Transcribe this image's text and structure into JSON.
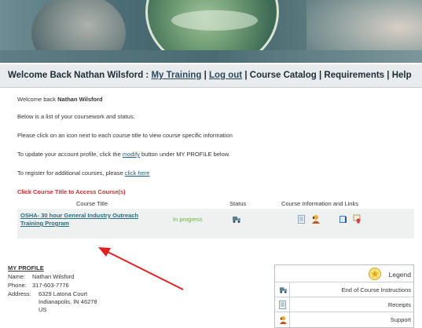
{
  "nav": {
    "welcome": "Welcome Back Nathan Wilsford :",
    "my_training": "My Training",
    "log_out": "Log out",
    "course_catalog": "Course Catalog",
    "requirements": "Requirements",
    "help": "Help",
    "sep": "|"
  },
  "intro": {
    "welcome_prefix": "Welcome back ",
    "welcome_name": "Nathan Wilsford",
    "line_list": "Below is a list of your coursework and status.",
    "line_click": "Please click on an icon next to each course title to view course specific information",
    "modify_prefix": "To update your account profile, click the ",
    "modify_link": "modify",
    "modify_suffix": " button under MY PROFILE below.",
    "register_prefix": "To register for additional courses, please ",
    "register_link": "click here",
    "access_notice": "Click Course Title to Access Course(s)"
  },
  "courses": {
    "headers": {
      "title": "Course Title",
      "status": "Status",
      "info": "Course Information and Links"
    },
    "rows": [
      {
        "title_line1": "OSHA- 30 hour General Industry Outreach",
        "title_line2": "Training Program",
        "status": "In progress",
        "icons": [
          "end-of-course-instructions-icon",
          "receipt-icon",
          "support-icon",
          "book-icon",
          "certificate-icon"
        ]
      }
    ]
  },
  "profile": {
    "title": "MY PROFILE",
    "name_label": "Name:",
    "name": "Nathan Wilsford",
    "phone_label": "Phone:",
    "phone": "317-603-7776",
    "address_label": "Address:",
    "address_line1": "6329 Latona Court",
    "address_line2": "Indianapolis, IN 46278",
    "address_line3": "US"
  },
  "legend": {
    "title": "Legend",
    "items": [
      {
        "label": "End of Course Instructions",
        "icon": "truck-icon"
      },
      {
        "label": "Receipts",
        "icon": "receipt-icon"
      },
      {
        "label": "Support",
        "icon": "support-icon"
      }
    ]
  },
  "colors": {
    "link": "#1f5d85",
    "status_in_progress": "#6bb13e",
    "notice": "#d42a2a",
    "arrow": "#e02020"
  }
}
